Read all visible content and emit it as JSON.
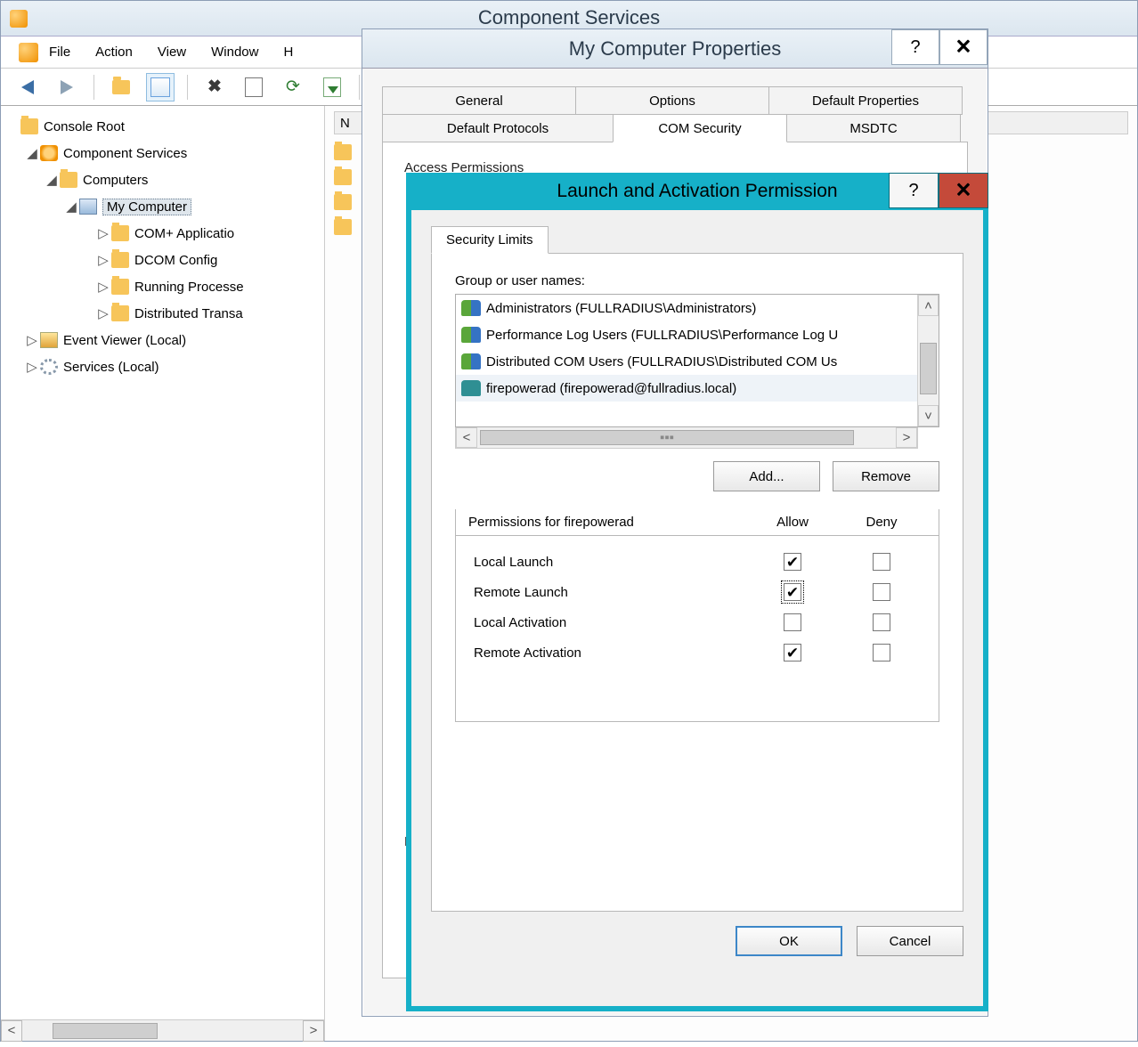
{
  "main": {
    "title": "Component Services",
    "menu": [
      "File",
      "Action",
      "View",
      "Window",
      "H"
    ],
    "tree": {
      "root": "Console Root",
      "nodes": {
        "component_services": "Component Services",
        "computers": "Computers",
        "my_computer": "My Computer",
        "com_apps": "COM+ Applicatio",
        "dcom_config": "DCOM Config",
        "running_proc": "Running Processe",
        "dist_trans": "Distributed Transa",
        "event_viewer": "Event Viewer (Local)",
        "services": "Services (Local)"
      }
    },
    "list_header_first": "N"
  },
  "props": {
    "title": "My Computer Properties",
    "tabs_row1": [
      "General",
      "Options",
      "Default Properties"
    ],
    "tabs_row2": [
      "Default Protocols",
      "COM Security",
      "MSDTC"
    ],
    "active_tab": "COM Security",
    "section_label_visible": "Access Permissions",
    "hint_letter": "L"
  },
  "perm": {
    "title": "Launch and Activation Permission",
    "tab": "Security Limits",
    "group_label": "Group or user names:",
    "users": [
      {
        "type": "g",
        "name": "Administrators (FULLRADIUS\\Administrators)"
      },
      {
        "type": "g",
        "name": "Performance Log Users (FULLRADIUS\\Performance Log U"
      },
      {
        "type": "g",
        "name": "Distributed COM Users (FULLRADIUS\\Distributed COM Us"
      },
      {
        "type": "u",
        "name": "firepowerad (firepowerad@fullradius.local)"
      }
    ],
    "add": "Add...",
    "remove": "Remove",
    "permissions_for": "Permissions for firepowerad",
    "allow": "Allow",
    "deny": "Deny",
    "rows": [
      {
        "name": "Local Launch",
        "allow": true,
        "deny": false,
        "focus": false
      },
      {
        "name": "Remote Launch",
        "allow": true,
        "deny": false,
        "focus": true
      },
      {
        "name": "Local Activation",
        "allow": false,
        "deny": false,
        "focus": false
      },
      {
        "name": "Remote Activation",
        "allow": true,
        "deny": false,
        "focus": false
      }
    ],
    "ok": "OK",
    "cancel": "Cancel"
  },
  "glyph": {
    "help": "?",
    "close": "🗙",
    "up": "˄",
    "down": "˅",
    "left": "<",
    "right": ">",
    "grip": "▪▪▪"
  }
}
